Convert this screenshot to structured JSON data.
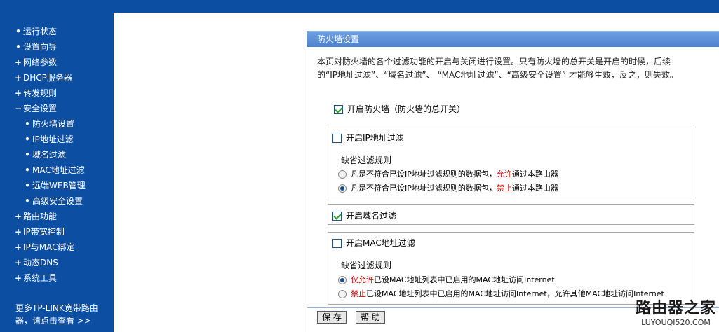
{
  "sidebar": {
    "items": [
      {
        "label": "运行状态",
        "marker": "•"
      },
      {
        "label": "设置向导",
        "marker": "•"
      },
      {
        "label": "网络参数",
        "marker": "+"
      },
      {
        "label": "DHCP服务器",
        "marker": "+"
      },
      {
        "label": "转发规则",
        "marker": "+"
      },
      {
        "label": "安全设置",
        "marker": "−"
      },
      {
        "label": "防火墙设置",
        "marker": "•"
      },
      {
        "label": "IP地址过滤",
        "marker": "•"
      },
      {
        "label": "域名过滤",
        "marker": "•"
      },
      {
        "label": "MAC地址过滤",
        "marker": "•"
      },
      {
        "label": "远端WEB管理",
        "marker": "•"
      },
      {
        "label": "高级安全设置",
        "marker": "•"
      },
      {
        "label": "路由功能",
        "marker": "+"
      },
      {
        "label": "IP带宽控制",
        "marker": "+"
      },
      {
        "label": "IP与MAC绑定",
        "marker": "+"
      },
      {
        "label": "动态DNS",
        "marker": "+"
      },
      {
        "label": "系统工具",
        "marker": "+"
      }
    ],
    "more_line1": "更多TP-LINK宽带路由",
    "more_line2": "器，请点击查看 >>"
  },
  "panel": {
    "title": "防火墙设置",
    "description": "本页对防火墙的各个过滤功能的开启与关闭进行设置。只有防火墙的总开关是开启的时候，后续的“IP地址过滤”、“域名过滤”、 “MAC地址过滤”、“高级安全设置” 才能够生效，反之，则失效。",
    "master_label": "开启防火墙（防火墙的总开关）",
    "master_checked": true,
    "ip_filter": {
      "label": "开启IP地址过滤",
      "checked": false,
      "rule_title": "缺省过滤规则",
      "options": [
        {
          "pre": "凡是不符合已设IP地址过滤规则的数据包，",
          "key": "允许",
          "post": "通过本路由器",
          "selected": false
        },
        {
          "pre": "凡是不符合已设IP地址过滤规则的数据包，",
          "key": "禁止",
          "post": "通过本路由器",
          "selected": true
        }
      ]
    },
    "domain_filter": {
      "label": "开启域名过滤",
      "checked": true
    },
    "mac_filter": {
      "label": "开启MAC地址过滤",
      "checked": false,
      "rule_title": "缺省过滤规则",
      "options": [
        {
          "pre": "",
          "key": "仅允许",
          "post": "已设MAC地址列表中已启用的MAC地址访问Internet",
          "selected": true
        },
        {
          "pre": "",
          "key": "禁止",
          "post": "已设MAC地址列表中已启用的MAC地址访问Internet，允许其他MAC地址访问Internet",
          "selected": false
        }
      ]
    },
    "save_label": "保 存",
    "help_label": "帮 助"
  },
  "watermark": {
    "title": "路由器之家",
    "url": "LUYOUQI520.COM"
  },
  "colors": {
    "nav_blue": "#0b4ea2",
    "accent_red": "#d10000"
  }
}
